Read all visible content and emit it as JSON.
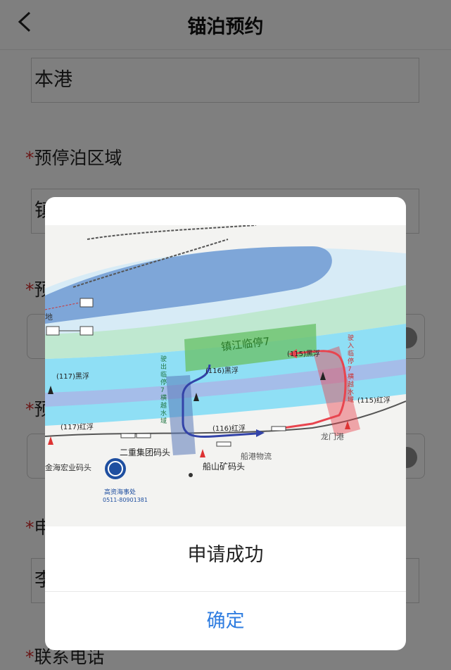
{
  "nav": {
    "title": "锚泊预约"
  },
  "form": {
    "port_value": "本港",
    "area_label": "预停泊区域",
    "area_value": "镇",
    "label3": "预",
    "label4": "预",
    "label5": "申",
    "name_value": "李",
    "phone_label": "联系电话",
    "required_mark": "*"
  },
  "map": {
    "zone_title": "镇江临停7",
    "left_zone": "驶出临停7横越水域",
    "right_zone": "驶入临停7横越水域",
    "buoys": [
      "(117)黑浮",
      "(116)黑浮",
      "(115)黑浮",
      "(117)红浮",
      "(116)红浮",
      "(115)红浮"
    ],
    "places": [
      "二重集团码头",
      "船港物流",
      "龙门港",
      "船山矿码头",
      "金海宏业码头",
      "地"
    ],
    "agency": "高资海事处",
    "agency_phone": "0511-80901381",
    "colors": {
      "water": "#8fdff5",
      "channel": "#a9b7e6",
      "anchor_zone": "#7cc97c",
      "inbound": "#e8454f",
      "outbound": "#3343a8",
      "land": "#f3f3f1"
    }
  },
  "dialog": {
    "message": "申请成功",
    "confirm": "确定"
  }
}
